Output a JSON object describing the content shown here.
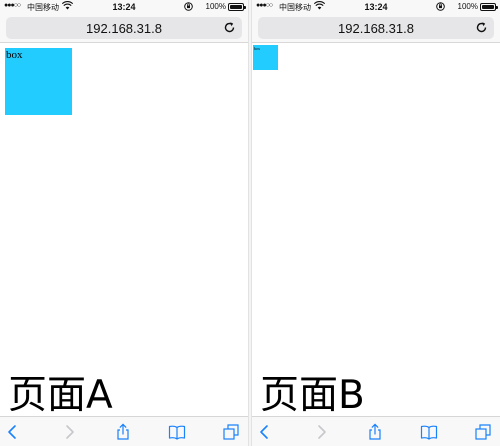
{
  "colors": {
    "accent": "#1a82fb",
    "box": "#22ccff",
    "disabled": "#c7c7cc"
  },
  "screens": [
    {
      "status": {
        "signal": "●●●○○",
        "carrier": "中国移动",
        "time": "13:24",
        "battery": "100%"
      },
      "address": {
        "url": "192.168.31.8"
      },
      "content": {
        "box_text": "box",
        "label": "页面A"
      },
      "toolbar": {
        "icons": [
          "back-icon",
          "forward-icon",
          "share-icon",
          "bookmarks-icon",
          "tabs-icon"
        ]
      }
    },
    {
      "status": {
        "signal": "●●●○○",
        "carrier": "中国移动",
        "time": "13:24",
        "battery": "100%"
      },
      "address": {
        "url": "192.168.31.8"
      },
      "content": {
        "box_text": "box",
        "label": "页面B"
      },
      "toolbar": {
        "icons": [
          "back-icon",
          "forward-icon",
          "share-icon",
          "bookmarks-icon",
          "tabs-icon"
        ]
      }
    }
  ]
}
